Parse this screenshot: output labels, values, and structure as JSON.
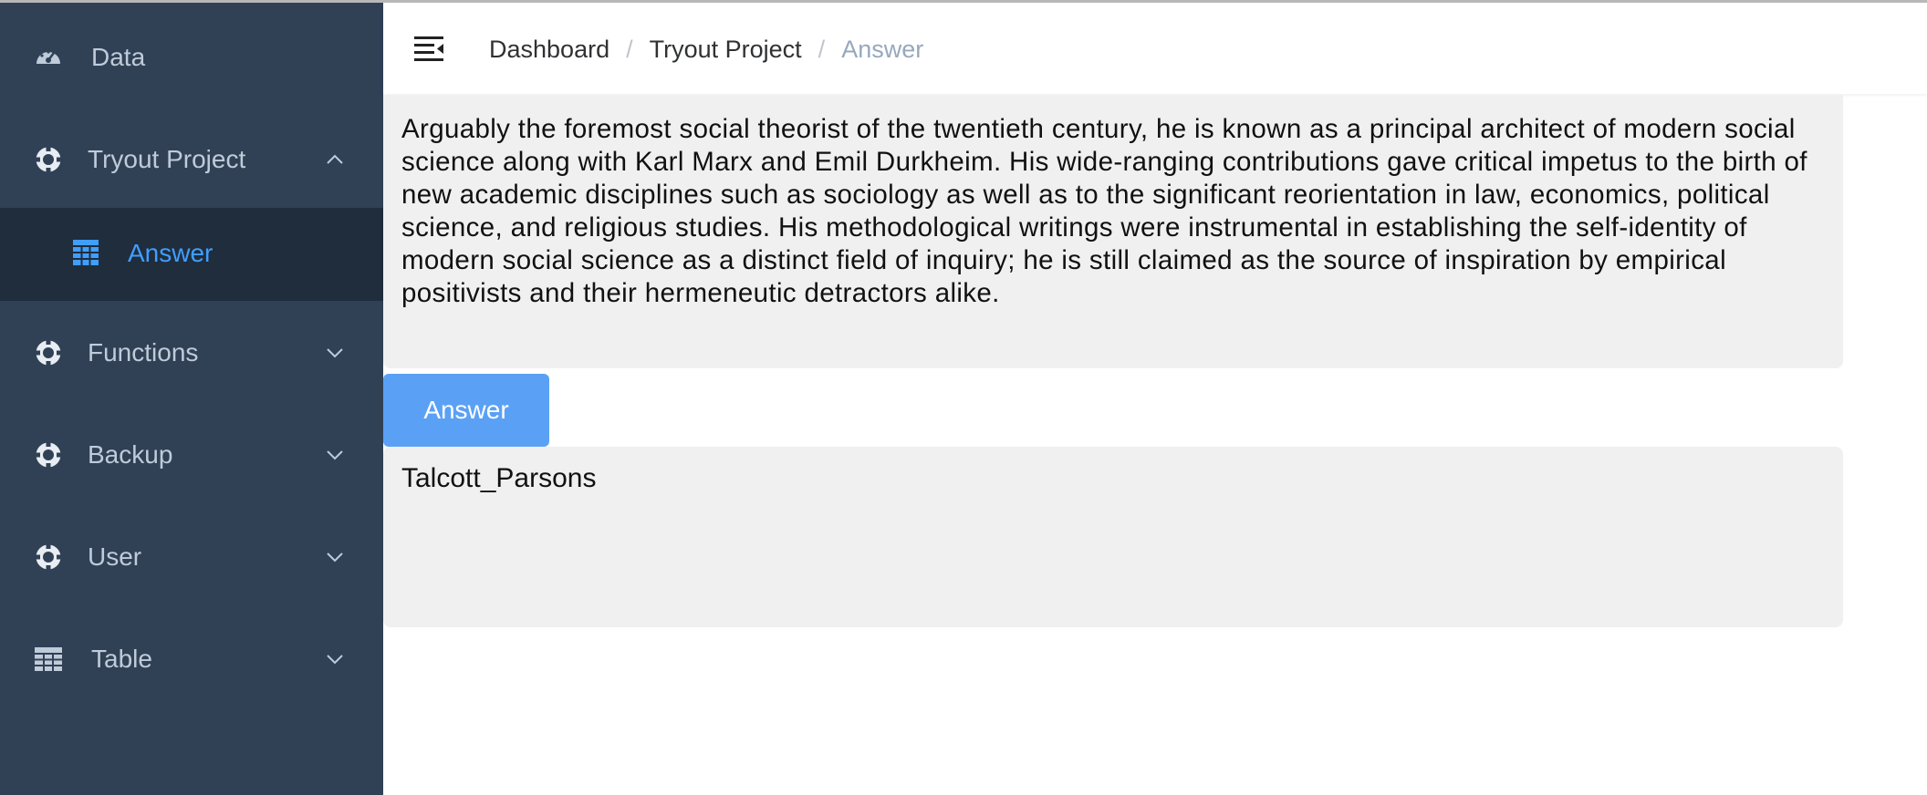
{
  "sidebar": {
    "items": [
      {
        "label": "Data",
        "icon": "dashboard-icon"
      },
      {
        "label": "Tryout Project",
        "icon": "settings-icon",
        "expanded": true
      },
      {
        "label": "Answer",
        "icon": "table-icon",
        "active": true
      },
      {
        "label": "Functions",
        "icon": "settings-icon"
      },
      {
        "label": "Backup",
        "icon": "settings-icon"
      },
      {
        "label": "User",
        "icon": "settings-icon"
      },
      {
        "label": "Table",
        "icon": "table-icon"
      }
    ]
  },
  "breadcrumb": [
    "Dashboard",
    "Tryout Project",
    "Answer"
  ],
  "main": {
    "question_text": "Arguably the foremost social theorist of the twentieth century, he is known as a principal architect of modern social science along with Karl Marx and Emil Durkheim. His wide-ranging contributions gave critical impetus to the birth of new academic disciplines such as sociology as well as to the significant reorientation in law, economics, political science, and religious studies. His methodological writings were instrumental in establishing the self-identity of modern social science as a distinct field of inquiry; he is still claimed as the source of inspiration by empirical positivists and their hermeneutic detractors alike.",
    "answer_button_label": "Answer",
    "answer_text": "Talcott_Parsons"
  },
  "colors": {
    "sidebar_bg": "#304156",
    "sidebar_active_bg": "#1f2d3d",
    "accent": "#409eff",
    "button": "#5aa1f5"
  }
}
